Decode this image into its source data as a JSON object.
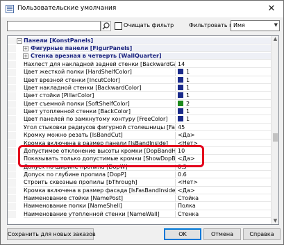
{
  "window": {
    "title": "Пользовательские умолчания",
    "close_glyph": "✕"
  },
  "toolbar": {
    "search": {
      "value": "",
      "placeholder": ""
    },
    "clear_filter_label": "Очищать фильтр",
    "filter_by_label": "Фильтровать по:",
    "filter_by_value": "Имя"
  },
  "grid": {
    "group": {
      "label": "Панели [KonstPanels]",
      "expanded": true
    },
    "subgroups": [
      {
        "label": "Фигурные панели [FigurPanels]",
        "expanded": false
      },
      {
        "label": "Стенка врезная в четверть [WallQuarter]",
        "expanded": false
      }
    ],
    "rows": [
      {
        "name": "Нахлест для накладной задней стенки [BackwardGaps]",
        "value": "14"
      },
      {
        "name": "Цвет жесткой полки [HardShelfColor]",
        "value": "1",
        "swatch": "#1a2a8a"
      },
      {
        "name": "Цвет врезной стенки [IncutColor]",
        "value": "1",
        "swatch": "#1a2a8a"
      },
      {
        "name": "Цвет накладной стенки [BackwardColor]",
        "value": "1",
        "swatch": "#1a2a8a"
      },
      {
        "name": "Цвет стойки [PillarColor]",
        "value": "1",
        "swatch": "#1a2a8a"
      },
      {
        "name": "Цвет съемной полки [SoftShelfColor]",
        "value": "2",
        "swatch": "#1e8a1e"
      },
      {
        "name": "Цвет утопленной стенки [BackColor]",
        "value": "1",
        "swatch": "#1a2a8a"
      },
      {
        "name": "Цвет панелей по замкнутому контуру [FreeColor]",
        "value": "1",
        "swatch": "#1a2a8a"
      },
      {
        "name": "Угол стыковки радиусов фигурной столешницы [Fangle]",
        "value": "45"
      },
      {
        "name": "Кромку можно резать [IsBandCut]",
        "value": "<Да>"
      },
      {
        "name": "Кромка включена в размер панели [IsBandInside]",
        "value": "<Нет>"
      },
      {
        "name": "Допустимое отклонение высоты кромки [DopBandH]",
        "value": "10"
      },
      {
        "name": "Показывать только допустимые кромки [ShowDopBand]",
        "value": "<Да>"
      },
      {
        "name": "Допуск по ширине пропила [DopW]",
        "value": "0.5"
      },
      {
        "name": "Допуск по глубине пропила [DopP]",
        "value": "0.6"
      },
      {
        "name": "Строить сквозные пропилы [bThrough]",
        "value": "<Нет>"
      },
      {
        "name": "Кромка включена в размер фасада [IsFasBandInside]",
        "value": "<Да>"
      },
      {
        "name": "Наименование стойки [NamePost]",
        "value": "Стойка"
      },
      {
        "name": "Наименование полки [NameShell]",
        "value": "Полка"
      },
      {
        "name": "Наименование утопленной стенки [NameWall]",
        "value": "Стенка"
      }
    ]
  },
  "footer": {
    "save_new_orders_label": "Сохранить для новых заказов",
    "ok_label": "OK",
    "cancel_label": "Отмена",
    "help_label": "Справка"
  },
  "colors": {
    "highlight": "#e3001b",
    "group_text": "#1a237e",
    "accent": "#0078d7"
  }
}
